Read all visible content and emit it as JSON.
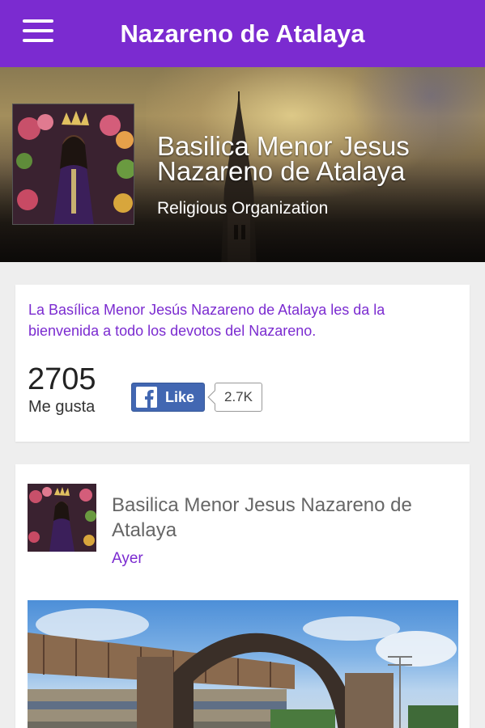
{
  "app": {
    "title": "Nazareno de Atalaya",
    "menu_icon": "hamburger-menu-icon"
  },
  "header": {
    "page_name": "Basilica Menor Jesus Nazareno de Atalaya",
    "category": "Religious Organization"
  },
  "about": {
    "description": "La Basílica Menor Jesús Nazareno de Atalaya les da la bienvenida a todo los devotos del Nazareno.",
    "likes_count": "2705",
    "likes_label": "Me gusta",
    "like_button_label": "Like",
    "like_button_icon": "facebook-icon",
    "like_total": "2.7K"
  },
  "post": {
    "author": "Basilica Menor Jesus Nazareno de Atalaya",
    "time": "Ayer"
  },
  "colors": {
    "accent": "#7b2bd0",
    "facebook": "#4267b2"
  }
}
